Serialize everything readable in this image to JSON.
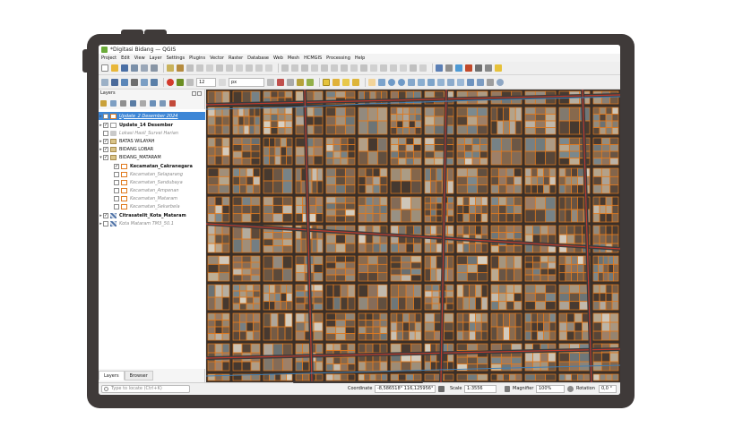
{
  "window": {
    "title": "*Digitasi Bidang — QGIS"
  },
  "menu": [
    "Project",
    "Edit",
    "View",
    "Layer",
    "Settings",
    "Plugins",
    "Vector",
    "Raster",
    "Database",
    "Web",
    "Mesh",
    "HCMGIS",
    "Processing",
    "Help"
  ],
  "toolbar2": {
    "font_size_value": "12",
    "unit_value": "px"
  },
  "layers_panel": {
    "title": "Layers",
    "tabs": [
      "Layers",
      "Browser"
    ],
    "items": [
      {
        "label": "Update_2 Desember 2024",
        "checked": false,
        "expander": true,
        "style": "selected",
        "symbol": "polygon-orange"
      },
      {
        "label": "Update_14 Desember",
        "checked": true,
        "expander": true,
        "style": "bold",
        "symbol": "polygon-white"
      },
      {
        "label": "Lokasi Hasil_Survei Harian",
        "checked": false,
        "expander": false,
        "style": "italic",
        "symbol": "point-gray"
      },
      {
        "label": "BATAS WILAYAH",
        "checked": true,
        "expander": true,
        "style": "normal",
        "symbol": "group-icon"
      },
      {
        "label": "BIDANG LOBAR",
        "checked": true,
        "expander": true,
        "style": "normal",
        "symbol": "group-icon"
      },
      {
        "label": "BIDANG_MATARAM",
        "checked": true,
        "expander": true,
        "style": "normal",
        "symbol": "group-icon"
      },
      {
        "label": "Kecamatan_Cakranegara",
        "checked": true,
        "expander": false,
        "style": "bold",
        "symbol": "polygon-orange"
      },
      {
        "label": "Kecamatan_Selaparang",
        "checked": false,
        "expander": false,
        "style": "italic",
        "symbol": "polygon-orange"
      },
      {
        "label": "Kecamatan_Sandubaya",
        "checked": false,
        "expander": false,
        "style": "italic",
        "symbol": "polygon-orange"
      },
      {
        "label": "Kecamatan_Ampenan",
        "checked": false,
        "expander": false,
        "style": "italic",
        "symbol": "polygon-orange"
      },
      {
        "label": "Kecamatan_Mataram",
        "checked": false,
        "expander": false,
        "style": "italic",
        "symbol": "polygon-orange"
      },
      {
        "label": "Kecamatan_Sekarbela",
        "checked": false,
        "expander": false,
        "style": "italic",
        "symbol": "polygon-orange"
      },
      {
        "label": "Citrasatelit_Kota_Mataram",
        "checked": true,
        "expander": true,
        "style": "bold",
        "symbol": "raster-icon"
      },
      {
        "label": "Kota Mataram TM3_50.1",
        "checked": false,
        "expander": true,
        "style": "italic",
        "symbol": "raster-icon"
      }
    ]
  },
  "statusbar": {
    "locator_placeholder": "Type to locate (Ctrl+K)",
    "coordinate_label": "Coordinate",
    "coordinate_value": "-8,586518° 116,125956°",
    "scale_label": "Scale",
    "scale_value": "1:3556",
    "magnifier_label": "Magnifier",
    "magnifier_value": "100%",
    "rotation_label": "Rotation",
    "rotation_value": "0,0 °"
  },
  "colors": {
    "parcel_outline": "#e07a1f",
    "road_line": "#c0392b",
    "selection_blue": "#3d86d6",
    "imagery_dark": "#3a2f28"
  }
}
